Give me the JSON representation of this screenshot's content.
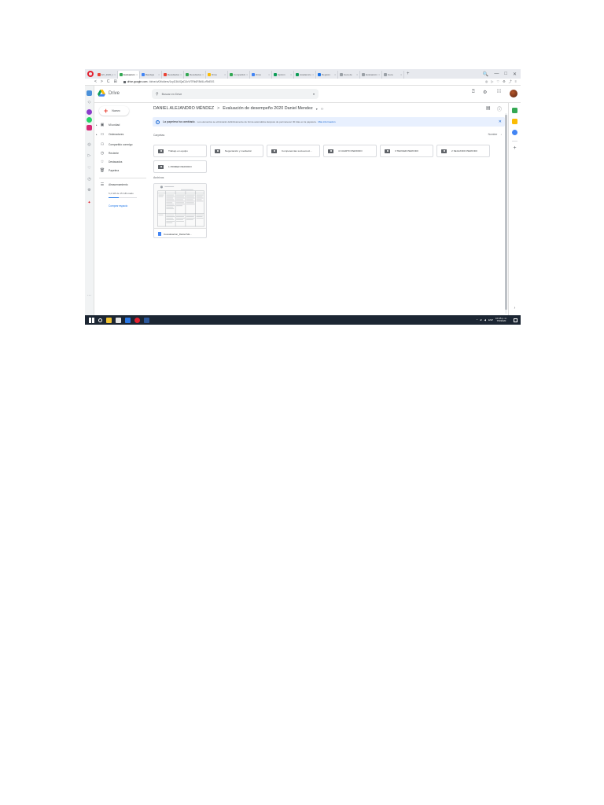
{
  "browser": {
    "tabs": [
      {
        "label": "EV_2020_C",
        "icon": "gmail-icon",
        "color": "#ea4335",
        "active": false
      },
      {
        "label": "Evaluación",
        "icon": "drive-icon",
        "color": "#34a853",
        "active": true
      },
      {
        "label": "Bandeja",
        "icon": "docs-icon",
        "color": "#4285f4",
        "active": false
      },
      {
        "label": "Resultados",
        "icon": "gmail-icon",
        "color": "#ea4335",
        "active": false
      },
      {
        "label": "Resultados",
        "icon": "drive-icon",
        "color": "#34a853",
        "active": false
      },
      {
        "label": "Drive",
        "icon": "drive-icon",
        "color": "#fbbc04",
        "active": false
      },
      {
        "label": "Compartido",
        "icon": "drive-icon",
        "color": "#34a853",
        "active": false
      },
      {
        "label": "Drive",
        "icon": "docs-icon",
        "color": "#4285f4",
        "active": false
      },
      {
        "label": "Opción",
        "icon": "classroom-icon",
        "color": "#0f9d58",
        "active": false
      },
      {
        "label": "Académico",
        "icon": "classroom-icon",
        "color": "#0f9d58",
        "active": false
      },
      {
        "label": "Registro",
        "icon": "docs-icon",
        "color": "#1a73e8",
        "active": false
      },
      {
        "label": "Guía de",
        "icon": "generic-icon",
        "color": "#9aa0a6",
        "active": false
      },
      {
        "label": "Evaluación",
        "icon": "generic-icon",
        "color": "#9aa0a6",
        "active": false
      },
      {
        "label": "Guía",
        "icon": "generic-icon",
        "color": "#9aa0a6",
        "active": false
      }
    ],
    "window_controls": {
      "search": "🔍",
      "minimize": "—",
      "maximize": "□",
      "close": "✕"
    },
    "nav": {
      "back": "<",
      "forward": ">",
      "reload": "C",
      "grid": "⊞"
    },
    "url": {
      "host": "drive.google.com",
      "path": "/drive/u/0/folders/1xyD3k0QaD2cVf7Rk6F8b5LvRbE0S"
    }
  },
  "drive": {
    "app_name": "Drive",
    "search_placeholder": "Buscar en Drive",
    "new_button": "Nuevo",
    "nav_items": [
      {
        "label": "Mi unidad",
        "icon": "my-drive-icon"
      },
      {
        "label": "Ordenadores",
        "icon": "computer-icon"
      },
      {
        "label": "Compartido conmigo",
        "icon": "shared-icon"
      },
      {
        "label": "Reciente",
        "icon": "recent-icon"
      },
      {
        "label": "Destacados",
        "icon": "star-icon"
      },
      {
        "label": "Papelera",
        "icon": "trash-icon"
      }
    ],
    "storage": {
      "label": "Almacenamiento",
      "usage": "5,2 GB de 15 GB usado",
      "used_fraction": 0.35,
      "buy_link": "Comprar espacio"
    },
    "breadcrumb": {
      "root": "DANIEL ALEJANDRO MÉNDEZ",
      "separator": ">",
      "current": "Evaluación de desempeño 2020 Daniel Mendez"
    },
    "banner": {
      "title": "La papelera ha cambiado.",
      "text": "Los elementos se eliminarán definitivamente de forma automática después de permanecer 30 días en la papelera.",
      "link": "Más información",
      "close": "✕"
    },
    "folders_label": "Carpetas",
    "sort_label": "Nombre",
    "sort_dir": "↓",
    "folders": [
      "Trabajo en equipo",
      "Negociación y mediación",
      "Competencias socioemoci...",
      "4 CUARTO PERIODO",
      "3 TERCER PERIODO",
      "2 SEGUNDO PERIODO",
      "1 PRIMER PERIODO"
    ],
    "files_label": "Archivos",
    "files": [
      {
        "name": "Coevaluacion_Daniel Mé...",
        "type": "doc"
      }
    ]
  },
  "taskbar": {
    "lang": "ESP",
    "time": "10:45 p. m.",
    "date": "7/5/2020"
  },
  "colors": {
    "drive_blue": "#1a73e8",
    "banner_bg": "#e8f0fe",
    "taskbar": "#1c2633",
    "new_plus": "#ea4335"
  }
}
